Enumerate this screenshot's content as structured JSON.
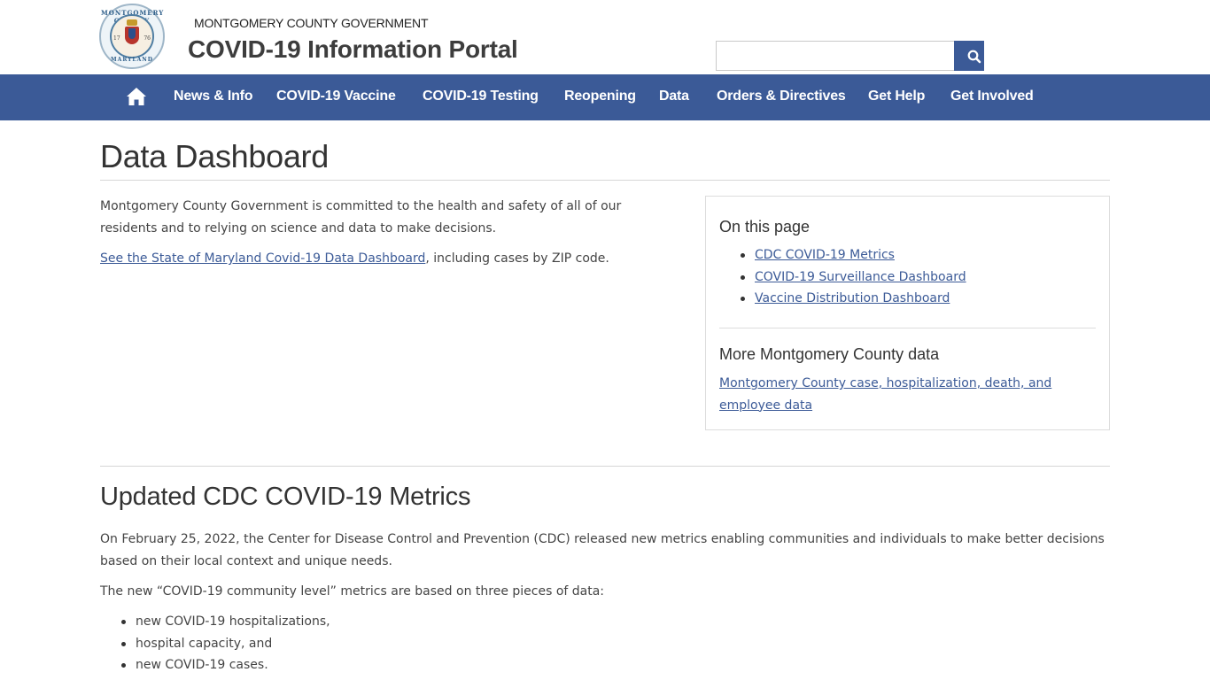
{
  "header": {
    "seal": {
      "top_text": "MONTGOMERY COUNTY",
      "bottom_text": "MARYLAND",
      "year_left": "17",
      "year_right": "76"
    },
    "gov_name": "MONTGOMERY COUNTY GOVERNMENT",
    "portal_title": "COVID-19 Information Portal",
    "search": {
      "placeholder": ""
    }
  },
  "nav": {
    "home_icon": "home-icon",
    "items": [
      "News & Info",
      "COVID-19 Vaccine",
      "COVID-19 Testing",
      "Reopening",
      "Data",
      "Orders & Directives",
      "Get Help",
      "Get Involved"
    ]
  },
  "page": {
    "title": "Data Dashboard",
    "intro": "Montgomery County Government is committed to the health and safety of all of our residents and to relying on science and data to make decisions.",
    "state_link": "See the State of Maryland Covid-19 Data Dashboard",
    "state_suffix": ", including cases by ZIP code."
  },
  "sidebar": {
    "on_this_page": "On this page",
    "links": [
      "CDC COVID-19 Metrics",
      "COVID-19 Surveillance Dashboard",
      "Vaccine Distribution Dashboard"
    ],
    "more_heading": "More Montgomery County data",
    "more_link": "Montgomery County case, hospitalization, death, and employee data"
  },
  "section": {
    "title": "Updated CDC COVID-19 Metrics",
    "para1": "On February 25, 2022, the Center for Disease Control and Prevention (CDC) released new metrics enabling communities and individuals to make better decisions based on their local context and unique needs.",
    "para2": "The new “COVID-19 community level” metrics are based on three pieces of data:",
    "bullets": [
      "new COVID-19 hospitalizations,",
      "hospital capacity, and",
      "new COVID-19 cases."
    ]
  },
  "colors": {
    "nav_bg": "#3b5a97",
    "link": "#3b5a97",
    "text": "#333333"
  }
}
